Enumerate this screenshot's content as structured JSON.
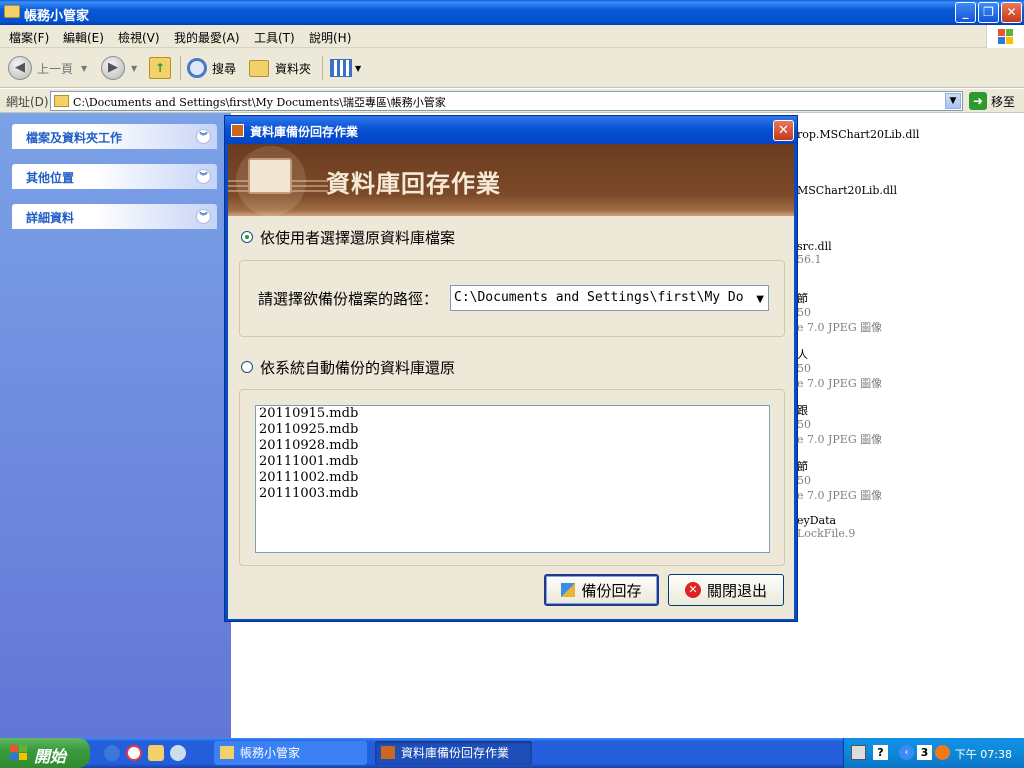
{
  "window": {
    "title": "帳務小管家"
  },
  "menu": [
    "檔案(F)",
    "編輯(E)",
    "檢視(V)",
    "我的最愛(A)",
    "工具(T)",
    "說明(H)"
  ],
  "toolbar": {
    "back": "上一頁",
    "search": "搜尋",
    "folders": "資料夾"
  },
  "address": {
    "label": "網址(D)",
    "path": "C:\\Documents and Settings\\first\\My Documents\\瑞亞專區\\帳務小管家",
    "go": "移至"
  },
  "tasks": [
    "檔案及資料夾工作",
    "其他位置",
    "詳細資料"
  ],
  "files": [
    {
      "name": "rop.MSChart20Lib.dll",
      "sub": ""
    },
    {
      "name": "MSChart20Lib.dll",
      "sub": ""
    },
    {
      "name": "src.dll",
      "sub": "56.1"
    },
    {
      "name": "節",
      "sub": "50",
      "type": "e 7.0 JPEG 圖像"
    },
    {
      "name": "人",
      "sub": "50",
      "type": "e 7.0 JPEG 圖像"
    },
    {
      "name": "跟",
      "sub": "50",
      "type": "e 7.0 JPEG 圖像"
    },
    {
      "name": "節",
      "sub": "50",
      "type": "e 7.0 JPEG 圖像"
    },
    {
      "name": "eyData",
      "sub": "LockFile.9"
    }
  ],
  "dialog": {
    "title": "資料庫備份回存作業",
    "banner": "資料庫回存作業",
    "option_user": "依使用者選擇還原資料庫檔案",
    "path_label": "請選擇欲備份檔案的路徑：",
    "path_value": "C:\\Documents and Settings\\first\\My Do",
    "option_auto": "依系統自動備份的資料庫還原",
    "backups": [
      "20110915.mdb",
      "20110925.mdb",
      "20110928.mdb",
      "20111001.mdb",
      "20111002.mdb",
      "20111003.mdb"
    ],
    "restore_btn": "備份回存",
    "close_btn": "關閉退出"
  },
  "taskbar": {
    "start": "開始",
    "tasks": [
      "帳務小管家",
      "資料庫備份回存作業"
    ],
    "tray_num": "3",
    "clock": "下午 07:38"
  }
}
